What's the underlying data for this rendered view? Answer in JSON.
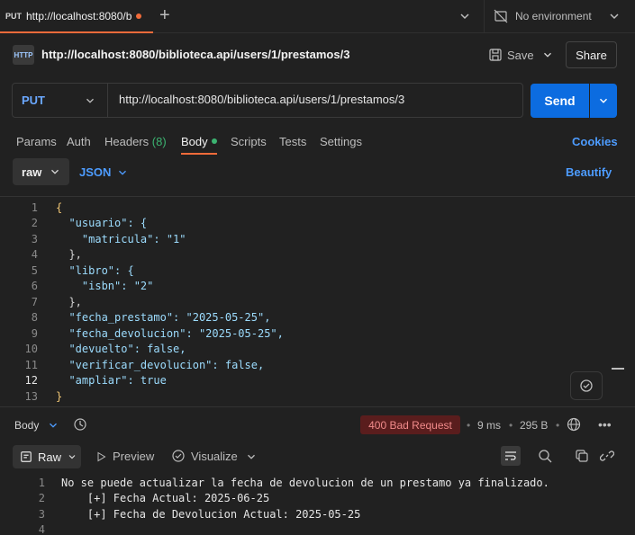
{
  "tab": {
    "method": "PUT",
    "title": "http://localhost:8080/bi"
  },
  "environment": {
    "label": "No environment"
  },
  "request": {
    "title": "http://localhost:8080/biblioteca.api/users/1/prestamos/3",
    "method": "PUT",
    "url": "http://localhost:8080/biblioteca.api/users/1/prestamos/3",
    "save_label": "Save",
    "share_label": "Share",
    "send_label": "Send",
    "http_badge": "HTTP"
  },
  "request_tabs": {
    "params": "Params",
    "auth": "Auth",
    "headers": "Headers",
    "headers_count": "(8)",
    "body": "Body",
    "scripts": "Scripts",
    "tests": "Tests",
    "settings": "Settings",
    "cookies": "Cookies"
  },
  "body_options": {
    "mode": "raw",
    "format": "JSON",
    "beautify": "Beautify"
  },
  "request_body": {
    "line_numbers": [
      "1",
      "2",
      "3",
      "4",
      "5",
      "6",
      "7",
      "8",
      "9",
      "10",
      "11",
      "12",
      "13"
    ],
    "lines": [
      "{",
      "  \"usuario\": {",
      "    \"matricula\": \"1\"",
      "  },",
      "  \"libro\": {",
      "    \"isbn\": \"2\"",
      "  },",
      "  \"fecha_prestamo\": \"2025-05-25\",",
      "  \"fecha_devolucion\": \"2025-05-25\",",
      "  \"devuelto\": false,",
      "  \"verificar_devolucion\": false,",
      "  \"ampliar\": true",
      "}"
    ]
  },
  "response": {
    "body_label": "Body",
    "status": "400 Bad Request",
    "time": "9 ms",
    "size": "295 B",
    "view_raw": "Raw",
    "view_preview": "Preview",
    "view_visualize": "Visualize",
    "line_numbers": [
      "1",
      "2",
      "3",
      "4"
    ],
    "lines": [
      "No se puede actualizar la fecha de devolucion de un prestamo ya finalizado.",
      "    [+] Fecha Actual: 2025-06-25",
      "    [+] Fecha de Devolucion Actual: 2025-05-25",
      ""
    ]
  },
  "colors": {
    "accent_orange": "#f26b3a",
    "send_blue": "#0c6ce0",
    "link_blue": "#4d9cff",
    "status_error_bg": "#5a1d1d",
    "status_error_fg": "#f08a8a",
    "success_green": "#3cb371"
  },
  "icons": {
    "tab_dot": "unsaved-dot-icon",
    "plus": "new-tab-icon",
    "env": "no-environment-icon",
    "save": "save-icon",
    "history": "history-icon",
    "globe": "globe-icon",
    "wrap": "wrap-lines-icon",
    "search": "search-icon",
    "copy": "copy-icon",
    "link": "link-icon"
  }
}
